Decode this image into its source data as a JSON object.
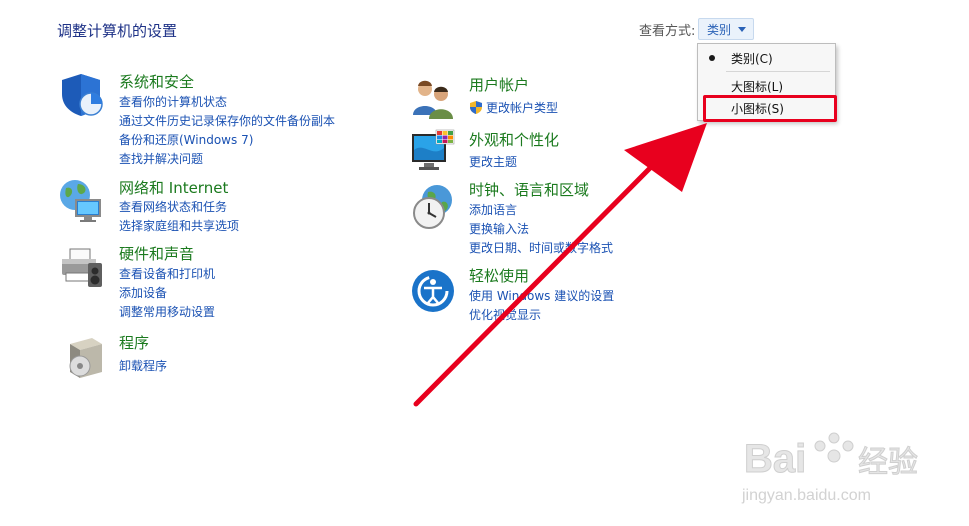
{
  "header": {
    "title": "调整计算机的设置",
    "view_by_label": "查看方式:",
    "view_by_value": "类别"
  },
  "dropdown": {
    "items": [
      {
        "label": "类别(C)",
        "checked": true
      },
      {
        "label": "大图标(L)",
        "checked": false
      },
      {
        "label": "小图标(S)",
        "checked": false
      }
    ]
  },
  "categories": [
    {
      "title": "系统和安全",
      "icon": "shield-icon",
      "links": [
        "查看你的计算机状态",
        "通过文件历史记录保存你的文件备份副本",
        "备份和还原(Windows 7)",
        "查找并解决问题"
      ]
    },
    {
      "title": "网络和 Internet",
      "icon": "network-globe-icon",
      "links": [
        "查看网络状态和任务",
        "选择家庭组和共享选项"
      ]
    },
    {
      "title": "硬件和声音",
      "icon": "printer-icon",
      "links": [
        "查看设备和打印机",
        "添加设备",
        "调整常用移动设置"
      ]
    },
    {
      "title": "程序",
      "icon": "programs-box-icon",
      "links": [
        "卸载程序"
      ]
    },
    {
      "title": "用户帐户",
      "icon": "users-icon",
      "links": [
        "更改帐户类型"
      ]
    },
    {
      "title": "外观和个性化",
      "icon": "monitor-colors-icon",
      "links": [
        "更改主题"
      ]
    },
    {
      "title": "时钟、语言和区域",
      "icon": "clock-globe-icon",
      "links": [
        "添加语言",
        "更换输入法",
        "更改日期、时间或数字格式"
      ]
    },
    {
      "title": "轻松使用",
      "icon": "ease-of-access-icon",
      "links": [
        "使用 Windows 建议的设置",
        "优化视觉显示"
      ]
    }
  ],
  "watermark": {
    "brand": "Baidu经验",
    "url": "jingyan.baidu.com"
  },
  "colors": {
    "category_title": "#1b7a1e",
    "link": "#1b52b3",
    "annotation_red": "#e8001e"
  }
}
